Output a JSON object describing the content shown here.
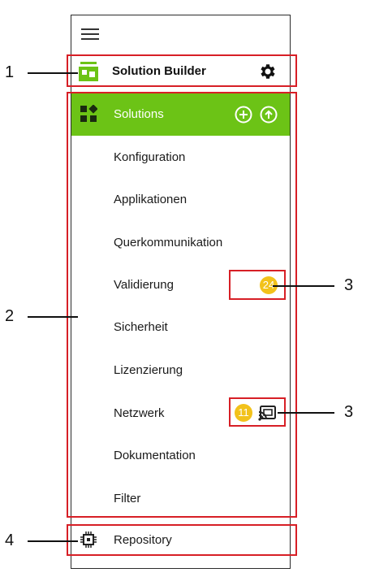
{
  "header": {
    "app_title": "Solution Builder",
    "logo_icon": "wago-app-logo-icon",
    "settings_icon": "gear-icon",
    "menu_icon": "hamburger-icon"
  },
  "solutions": {
    "label": "Solutions",
    "icon": "solutions-grid-icon",
    "add_icon": "plus-circle-icon",
    "upload_icon": "upload-circle-icon",
    "background_color": "#6cc316"
  },
  "nav": {
    "items": [
      {
        "label": "Konfiguration"
      },
      {
        "label": "Applikationen"
      },
      {
        "label": "Querkommunikation"
      },
      {
        "label": "Validierung",
        "badge": "24"
      },
      {
        "label": "Sicherheit"
      },
      {
        "label": "Lizenzierung"
      },
      {
        "label": "Netzwerk",
        "badge": "11",
        "icon": "cast-icon"
      },
      {
        "label": "Dokumentation"
      },
      {
        "label": "Filter"
      }
    ]
  },
  "repository": {
    "label": "Repository",
    "icon": "chip-icon"
  },
  "callouts": {
    "one": "1",
    "two": "2",
    "three_a": "3",
    "three_b": "3",
    "four": "4"
  },
  "colors": {
    "accent_green": "#6cc316",
    "badge_yellow": "#f2c21b",
    "callout_red": "#d71f26"
  }
}
